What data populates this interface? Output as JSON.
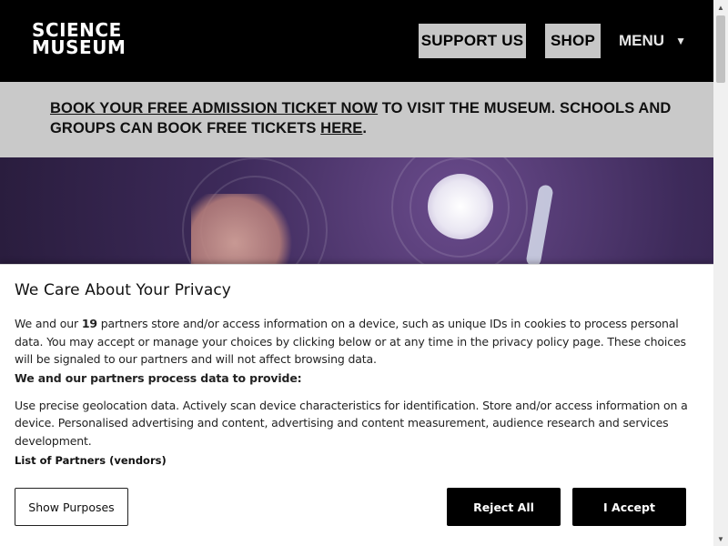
{
  "header": {
    "logo_line1": "SCIENCE",
    "logo_line2": "MUSEUM",
    "support_label": "SUPPORT US",
    "shop_label": "SHOP",
    "menu_label": "MENU",
    "menu_icon": "triangle-down-icon"
  },
  "banner": {
    "link1": "BOOK YOUR FREE ADMISSION TICKET NOW",
    "text1": " TO VISIT THE MUSEUM. SCHOOLS AND GROUPS CAN BOOK FREE TICKETS ",
    "link2": "HERE",
    "text2": "."
  },
  "privacy": {
    "title": "We Care About Your Privacy",
    "intro_before": "We and our ",
    "partners_count": "19",
    "intro_after": " partners store and/or access information on a device, such as unique IDs in cookies to process personal data. You may accept or manage your choices by clicking below or at any time in the privacy policy page. These choices will be signaled to our partners and will not affect browsing data.",
    "process_heading": "We and our partners process data to provide:",
    "purposes_text": "Use precise geolocation data. Actively scan device characteristics for identification. Store and/or access information on a device. Personalised advertising and content, advertising and content measurement, audience research and services development.",
    "partners_link": "List of Partners (vendors)",
    "show_purposes_label": "Show Purposes",
    "reject_label": "Reject All",
    "accept_label": "I Accept"
  },
  "scrollbar": {
    "up_icon": "arrow-up-icon",
    "down_icon": "arrow-down-icon"
  }
}
